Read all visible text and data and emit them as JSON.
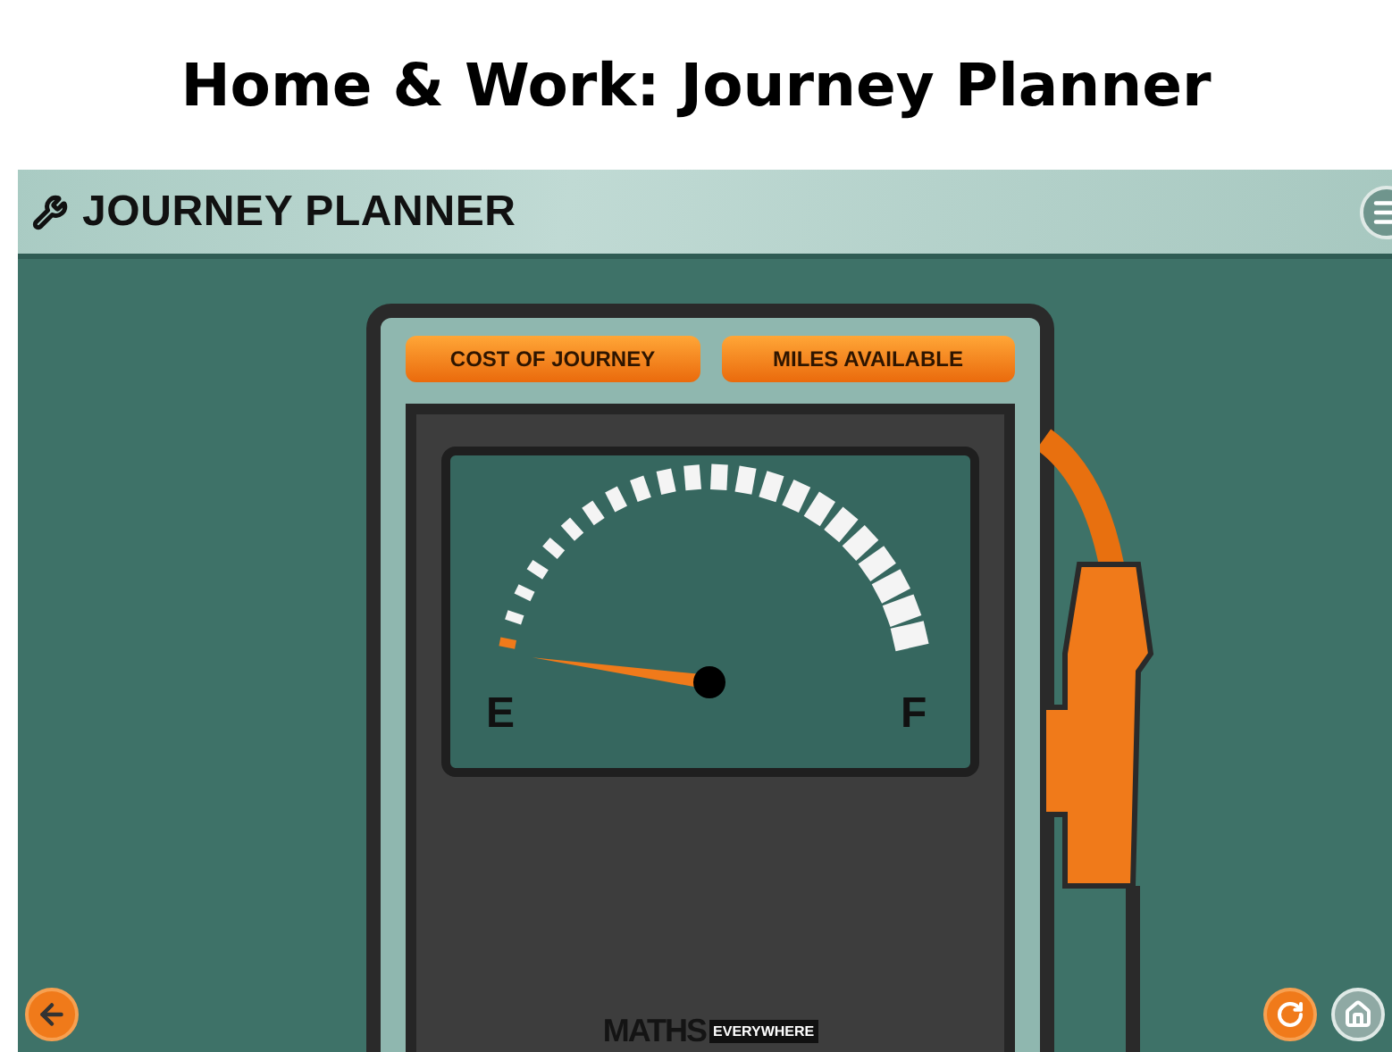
{
  "slide_title": "Home & Work: Journey Planner",
  "app": {
    "header": {
      "title": "JOURNEY PLANNER"
    },
    "pump": {
      "buttons": [
        "COST OF JOURNEY",
        "MILES AVAILABLE"
      ],
      "gauge": {
        "empty_label": "E",
        "full_label": "F"
      },
      "logo": {
        "main": "MATHS",
        "tag": "EVERYWHERE"
      }
    }
  }
}
